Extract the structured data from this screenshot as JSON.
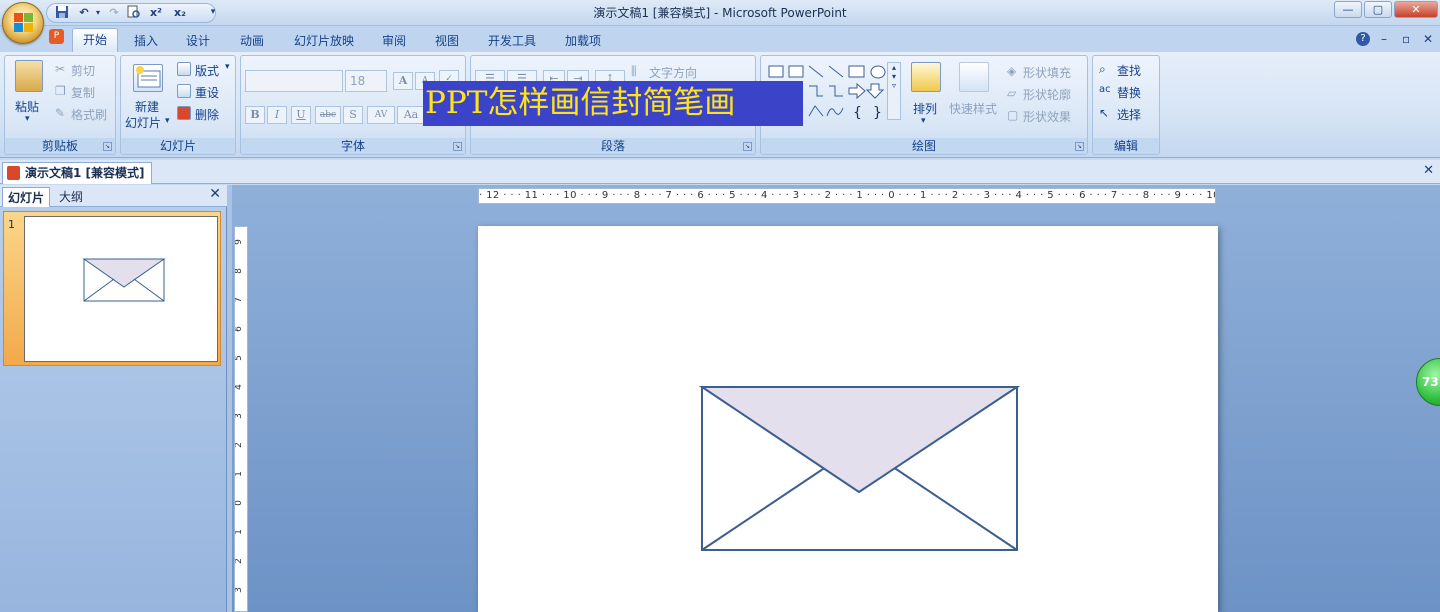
{
  "window": {
    "title": "演示文稿1 [兼容模式] - Microsoft PowerPoint",
    "controls": {
      "minimize": "—",
      "restore": "▢",
      "close": "✕"
    }
  },
  "quick_access": {
    "save_icon": "floppy-icon",
    "undo_icon": "undo-icon",
    "redo_icon": "redo-icon",
    "print_preview_icon": "print-preview-icon",
    "superscript": "x²",
    "subscript": "x₂",
    "more": "▾"
  },
  "ribbon_tabs": [
    "开始",
    "插入",
    "设计",
    "动画",
    "幻灯片放映",
    "审阅",
    "视图",
    "开发工具",
    "加载项"
  ],
  "active_tab": "开始",
  "ribbon_right": {
    "help": "?",
    "minimize": "–",
    "restore": "▫",
    "close": "✕"
  },
  "groups": {
    "clipboard": {
      "label": "剪贴板",
      "paste": "粘贴",
      "cut": "剪切",
      "copy": "复制",
      "format_painter": "格式刷"
    },
    "slides": {
      "label": "幻灯片",
      "new_slide_1": "新建",
      "new_slide_2": "幻灯片",
      "layout": "版式",
      "reset": "重设",
      "delete": "删除"
    },
    "font": {
      "label": "字体",
      "font_name": "",
      "font_size": "18",
      "buttons": [
        "B",
        "I",
        "U",
        "abc",
        "S",
        "AV",
        "Aa"
      ]
    },
    "paragraph": {
      "label": "段落",
      "text_direction": "文字方向"
    },
    "drawing": {
      "label": "绘图",
      "arrange": "排列",
      "quick_styles": "快速样式",
      "shape_fill": "形状填充",
      "shape_outline": "形状轮廓",
      "shape_effects": "形状效果"
    },
    "editing": {
      "label": "编辑",
      "find": "查找",
      "replace": "替换",
      "select": "选择"
    }
  },
  "document_tab": {
    "label": "演示文稿1 [兼容模式]",
    "close": "✕"
  },
  "left_pane": {
    "tabs": [
      "幻灯片",
      "大纲"
    ],
    "close": "✕",
    "slide_number": "1"
  },
  "ruler": {
    "horizontal": "· 12 · · · 11 · · · 10 · · · 9 · · · 8 · · · 7 · · · 6 · · · 5 · · · 4 · · · 3 · · · 2 · · · 1 · · · 0 · · · 1 · · · 2 · · · 3 · · · 4 · · · 5 · · · 6 · · · 7 · · · 8 · · · 9 · · · 10 · · · 11 · · · 12 ·",
    "vertical": [
      "9",
      "8",
      "7",
      "6",
      "5",
      "4",
      "3",
      "2",
      "1",
      "0",
      "1",
      "2",
      "3"
    ]
  },
  "overlay": {
    "title": "PPT怎样画信封简笔画"
  },
  "badge": {
    "value": "73"
  },
  "colors": {
    "envelope_stroke": "#3b5f8f",
    "envelope_flap_fill": "#e4dfec",
    "overlay_bg": "#3b44c8",
    "overlay_text": "#ffe31a"
  }
}
